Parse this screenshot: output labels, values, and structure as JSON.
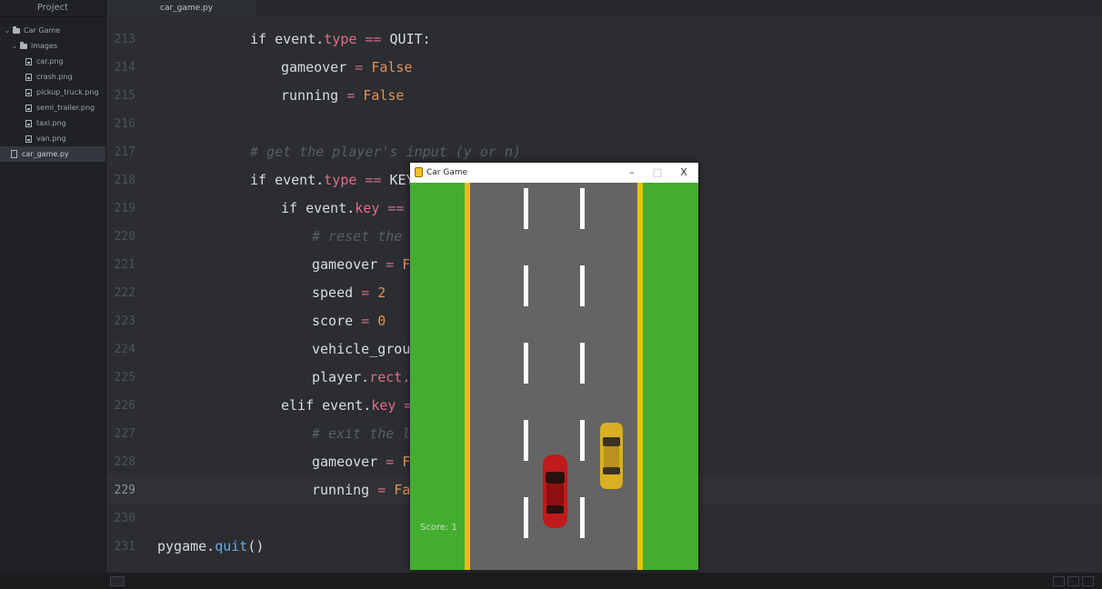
{
  "sidebar": {
    "header": "Project",
    "tree": [
      {
        "label": "Car Game",
        "icon": "folder-icon",
        "depth": 0,
        "expanded": true
      },
      {
        "label": "images",
        "icon": "folder-icon",
        "depth": 1,
        "expanded": true
      },
      {
        "label": "car.png",
        "icon": "image-file-icon",
        "depth": 2
      },
      {
        "label": "crash.png",
        "icon": "image-file-icon",
        "depth": 2
      },
      {
        "label": "pickup_truck.png",
        "icon": "image-file-icon",
        "depth": 2
      },
      {
        "label": "semi_trailer.png",
        "icon": "image-file-icon",
        "depth": 2
      },
      {
        "label": "taxi.png",
        "icon": "image-file-icon",
        "depth": 2
      },
      {
        "label": "van.png",
        "icon": "image-file-icon",
        "depth": 2
      },
      {
        "label": "car_game.py",
        "icon": "python-file-icon",
        "depth": 1,
        "selected": true
      }
    ]
  },
  "tabs": [
    {
      "label": "car_game.py",
      "active": true
    }
  ],
  "editor": {
    "active_line": 229,
    "lines": [
      {
        "n": 213,
        "indent": 3,
        "tokens": [
          [
            "kw",
            "if "
          ],
          [
            "plain",
            "event."
          ],
          [
            "attr",
            "type"
          ],
          [
            "op",
            " == "
          ],
          [
            "plain",
            "QUIT:"
          ]
        ]
      },
      {
        "n": 214,
        "indent": 4,
        "tokens": [
          [
            "plain",
            "gameover "
          ],
          [
            "op",
            "= "
          ],
          [
            "bool",
            "False"
          ]
        ]
      },
      {
        "n": 215,
        "indent": 4,
        "tokens": [
          [
            "plain",
            "running "
          ],
          [
            "op",
            "= "
          ],
          [
            "bool",
            "False"
          ]
        ]
      },
      {
        "n": 216,
        "indent": 0,
        "tokens": []
      },
      {
        "n": 217,
        "indent": 3,
        "tokens": [
          [
            "comment",
            "# get the player's input (y or n)"
          ]
        ]
      },
      {
        "n": 218,
        "indent": 3,
        "tokens": [
          [
            "kw",
            "if "
          ],
          [
            "plain",
            "event."
          ],
          [
            "attr",
            "type"
          ],
          [
            "op",
            " == "
          ],
          [
            "plain",
            "KEY"
          ]
        ]
      },
      {
        "n": 219,
        "indent": 4,
        "tokens": [
          [
            "kw",
            "if "
          ],
          [
            "plain",
            "event."
          ],
          [
            "attr",
            "key"
          ],
          [
            "op",
            " =="
          ]
        ]
      },
      {
        "n": 220,
        "indent": 5,
        "tokens": [
          [
            "comment",
            "# reset the"
          ]
        ]
      },
      {
        "n": 221,
        "indent": 5,
        "tokens": [
          [
            "plain",
            "gameover "
          ],
          [
            "op",
            "= "
          ],
          [
            "bool",
            "F"
          ]
        ]
      },
      {
        "n": 222,
        "indent": 5,
        "tokens": [
          [
            "plain",
            "speed "
          ],
          [
            "op",
            "= "
          ],
          [
            "num",
            "2"
          ]
        ]
      },
      {
        "n": 223,
        "indent": 5,
        "tokens": [
          [
            "plain",
            "score "
          ],
          [
            "op",
            "= "
          ],
          [
            "num",
            "0"
          ]
        ]
      },
      {
        "n": 224,
        "indent": 5,
        "tokens": [
          [
            "plain",
            "vehicle_grou"
          ]
        ]
      },
      {
        "n": 225,
        "indent": 5,
        "tokens": [
          [
            "plain",
            "player."
          ],
          [
            "attr",
            "rect."
          ]
        ]
      },
      {
        "n": 226,
        "indent": 4,
        "tokens": [
          [
            "kw",
            "elif "
          ],
          [
            "plain",
            "event."
          ],
          [
            "attr",
            "key"
          ],
          [
            "op",
            " ="
          ]
        ]
      },
      {
        "n": 227,
        "indent": 5,
        "tokens": [
          [
            "comment",
            "# exit the l"
          ]
        ]
      },
      {
        "n": 228,
        "indent": 5,
        "tokens": [
          [
            "plain",
            "gameover "
          ],
          [
            "op",
            "= "
          ],
          [
            "bool",
            "F"
          ]
        ]
      },
      {
        "n": 229,
        "indent": 5,
        "tokens": [
          [
            "plain",
            "running "
          ],
          [
            "op",
            "= "
          ],
          [
            "bool",
            "Fa"
          ]
        ]
      },
      {
        "n": 230,
        "indent": 0,
        "tokens": []
      },
      {
        "n": 231,
        "indent": 0,
        "tokens": [
          [
            "plain",
            "pygame."
          ],
          [
            "fn",
            "quit"
          ],
          [
            "plain",
            "()"
          ]
        ]
      }
    ]
  },
  "game_window": {
    "title": "Car Game",
    "controls": {
      "minimize": "–",
      "maximize": "□",
      "close": "X"
    },
    "score_text": "Score: 1",
    "colors": {
      "grass": "#43ad30",
      "road": "#646464",
      "edge": "#e8c000",
      "lane": "#ffffff",
      "player_car": "#c01a1a",
      "taxi": "#d9b021"
    }
  }
}
